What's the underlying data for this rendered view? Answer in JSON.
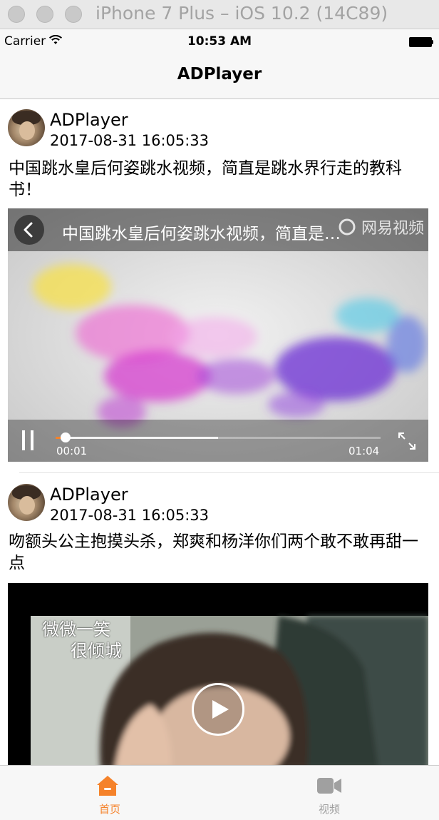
{
  "simulator": {
    "title": "iPhone 7 Plus – iOS 10.2 (14C89)"
  },
  "status_bar": {
    "carrier": "Carrier",
    "time": "10:53 AM"
  },
  "nav": {
    "title": "ADPlayer"
  },
  "posts": [
    {
      "username": "ADPlayer",
      "date": "2017-08-31 16:05:33",
      "caption": "中国跳水皇后何姿跳水视频，简直是跳水界行走的教科书！",
      "player": {
        "title": "中国跳水皇后何姿跳水视频，简直是…",
        "watermark": "网易视频",
        "current_time": "00:01",
        "duration": "01:04",
        "progress": 0.02,
        "buffered": 0.5,
        "state": "playing"
      }
    },
    {
      "username": "ADPlayer",
      "date": "2017-08-31 16:05:33",
      "caption": "吻额头公主抱摸头杀，郑爽和杨洋你们两个敢不敢再甜一点",
      "player": {
        "overlay_text_1": "微微一笑",
        "overlay_text_2": "很倾城",
        "state": "paused"
      }
    }
  ],
  "tabbar": {
    "items": [
      {
        "label": "首页",
        "icon": "home-icon",
        "active": true
      },
      {
        "label": "视频",
        "icon": "video-camera-icon",
        "active": false
      }
    ]
  },
  "colors": {
    "accent": "#f5822a",
    "inactive": "#a0a0a0"
  }
}
